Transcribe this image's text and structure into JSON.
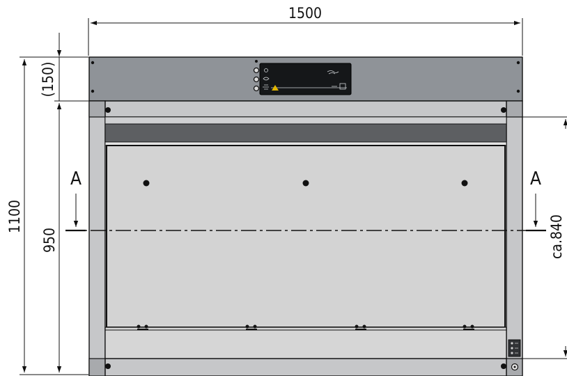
{
  "dimensions": {
    "width_total": "1500",
    "height_total": "1100",
    "top_panel": "(150)",
    "inner_height": "950",
    "opening": "ca.840"
  },
  "section_labels": {
    "left": "A",
    "right": "A"
  },
  "colors": {
    "top_panel": "#8f9398",
    "frame": "#c6c7c9",
    "back_panel": "#d4d4d4",
    "dark_band": "#5d5f62",
    "lines": "#111111"
  }
}
